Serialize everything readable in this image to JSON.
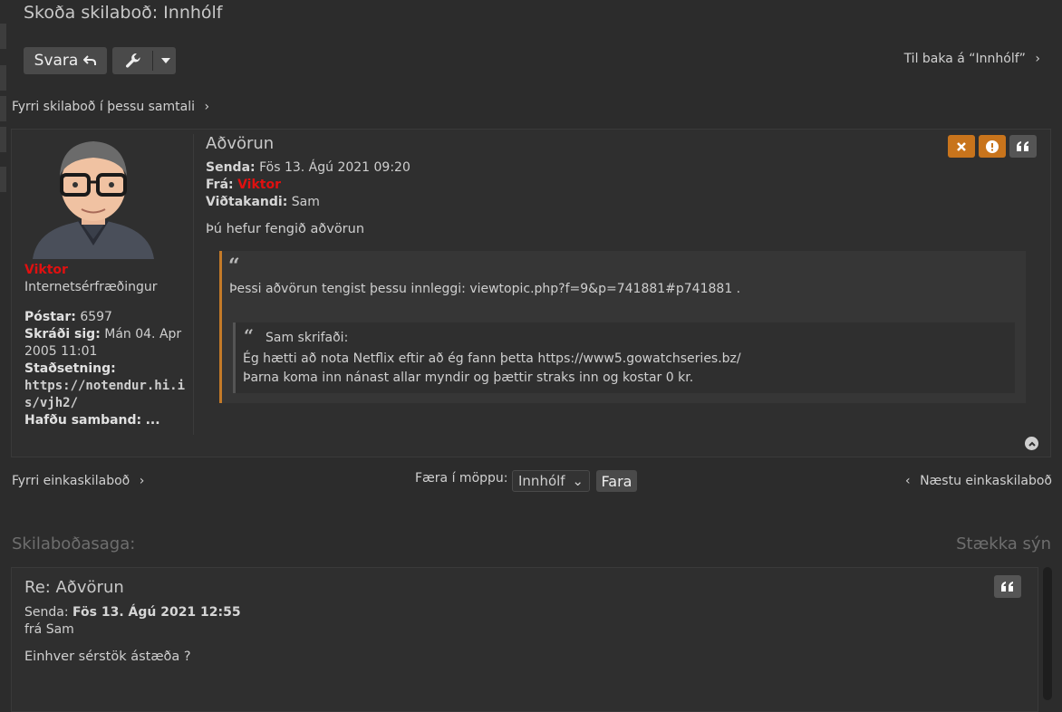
{
  "page": {
    "title": "Skoða skilaboð: Innhólf"
  },
  "toolbar": {
    "reply_label": "Svara",
    "back_link": "Til baka á “Innhólf”"
  },
  "nav": {
    "prev_in_conversation": "Fyrri skilaboð í þessu samtali",
    "prev_pm": "Fyrri einkaskilaboð",
    "next_pm": "Næstu einkaskilaboð",
    "move_label": "Færa í möppu:",
    "folder_selected": "Innhólf",
    "go_label": "Fara"
  },
  "profile": {
    "username": "Viktor",
    "rank": "Internetsérfræðingur",
    "posts_label": "Póstar:",
    "posts_value": "6597",
    "registered_label": "Skráði sig:",
    "registered_value": "Mán 04. Apr 2005 11:01",
    "location_label": "Staðsetning:",
    "location_value": "https://notendur.hi.is/vjh2/",
    "contact_label": "Hafðu samband:",
    "contact_value": "..."
  },
  "message": {
    "subject": "Aðvörun",
    "sent_label": "Senda:",
    "sent_value": "Fös 13. Ágú 2021 09:20",
    "from_label": "Frá:",
    "from_value": "Viktor",
    "to_label": "Viðtakandi:",
    "to_value": "Sam",
    "body": "Þú hefur fengið aðvörun",
    "quote_text": "Þessi aðvörun tengist þessu innleggi: viewtopic.php?f=9&p=741881#p741881 .",
    "inner_quote_author": "Sam skrifaði:",
    "inner_quote_line1": "Ég hætti að nota Netflix eftir að ég fann þetta https://www5.gowatchseries.bz/",
    "inner_quote_line2": "Þarna koma inn nánast allar myndir og þættir straks inn og kostar 0 kr."
  },
  "history": {
    "title": "Skilaboðasaga:",
    "expand": "Stækka sýn",
    "subject": "Re: Aðvörun",
    "sent_label": "Senda:",
    "sent_value": "Fös 13. Ágú 2021 12:55",
    "from_text": "frá Sam",
    "body": "Einhver sérstök ástæða ?"
  },
  "colors": {
    "background": "#2c2c2c",
    "username": "#e01010",
    "warning_button": "#c8741c",
    "quote_border": "#c47a28"
  }
}
